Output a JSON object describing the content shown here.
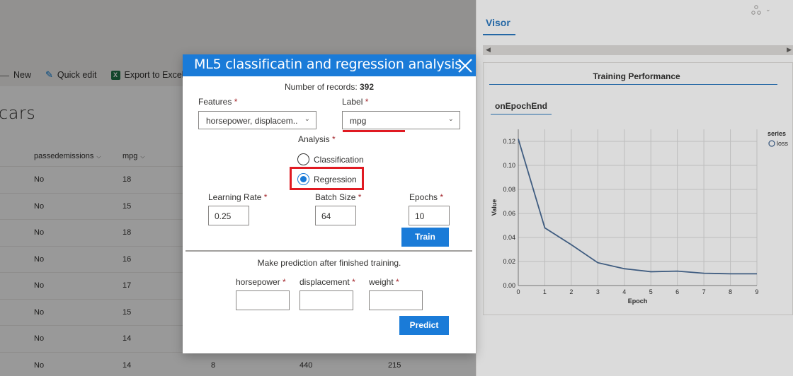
{
  "list": {
    "commands": {
      "new": "New",
      "quick_edit": "Quick edit",
      "export": "Export to Excel"
    },
    "title": "cars",
    "columns": [
      "passedemissions",
      "mpg"
    ],
    "rows": [
      {
        "passedemissions": "No",
        "mpg": "18"
      },
      {
        "passedemissions": "No",
        "mpg": "15"
      },
      {
        "passedemissions": "No",
        "mpg": "18"
      },
      {
        "passedemissions": "No",
        "mpg": "16"
      },
      {
        "passedemissions": "No",
        "mpg": "17"
      },
      {
        "passedemissions": "No",
        "mpg": "15"
      },
      {
        "passedemissions": "No",
        "mpg": "14"
      },
      {
        "passedemissions": "No",
        "mpg": "14",
        "c3": "8",
        "c4": "440",
        "c5": "215"
      }
    ]
  },
  "panel": {
    "tab": "Visor",
    "card_title": "Training Performance",
    "sub_tab": "onEpochEnd"
  },
  "chart_data": {
    "type": "line",
    "title": "",
    "xlabel": "Epoch",
    "ylabel": "Value",
    "legend_title": "series",
    "legend_position": "top-right",
    "grid": true,
    "xlim": [
      0,
      9
    ],
    "ylim": [
      0,
      0.13
    ],
    "x_ticks": [
      "0",
      "1",
      "2",
      "3",
      "4",
      "5",
      "6",
      "7",
      "8",
      "9"
    ],
    "y_ticks": [
      "0.00",
      "0.02",
      "0.04",
      "0.06",
      "0.08",
      "0.10",
      "0.12"
    ],
    "series": [
      {
        "name": "loss",
        "color": "#4a6c96",
        "x": [
          0,
          1,
          2,
          3,
          4,
          5,
          6,
          7,
          8,
          9
        ],
        "y": [
          0.122,
          0.048,
          0.034,
          0.019,
          0.014,
          0.0115,
          0.012,
          0.0102,
          0.0098,
          0.0098
        ]
      }
    ]
  },
  "modal": {
    "title": "ML5 classificatin and regression analysis",
    "records_label": "Number of records:",
    "records_value": "392",
    "features_label": "Features",
    "features_value": "horsepower, displacem...",
    "label_label": "Label",
    "label_value": "mpg",
    "required_mark": "*",
    "analysis_label": "Analysis",
    "analysis_options": [
      "Classification",
      "Regression"
    ],
    "analysis_selected": "Regression",
    "learning_rate_label": "Learning Rate",
    "learning_rate_value": "0.25",
    "batch_size_label": "Batch Size",
    "batch_size_value": "64",
    "epochs_label": "Epochs",
    "epochs_value": "10",
    "train_button": "Train",
    "predict_message": "Make prediction after finished training.",
    "horsepower_label": "horsepower",
    "displacement_label": "displacement",
    "weight_label": "weight",
    "predict_button": "Predict"
  },
  "colors": {
    "accent": "#1a7bd8",
    "highlight": "#e01a22"
  }
}
